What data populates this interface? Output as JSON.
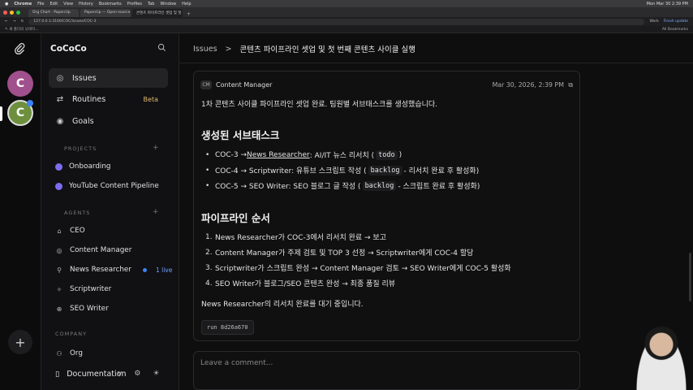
{
  "macbar": {
    "app": "Chrome",
    "menus": [
      "File",
      "Edit",
      "View",
      "History",
      "Bookmarks",
      "Profiles",
      "Tab",
      "Window",
      "Help"
    ],
    "clock": "Mon Mar 30 2:39 PM"
  },
  "browser": {
    "tabs": [
      "Org Chart · Paperclip",
      "Paperclip — Open-source or...",
      "콘텐츠 파이프라인 셋업 및 첫 번..."
    ],
    "url": "127.0.0.1:3100/COC/issues/COC-3",
    "bookmarks": "✎ 새 폴더의 닛네이...",
    "work_label": "Work",
    "finish_update": "Finish update",
    "all_bookmarks": "All Bookmarks"
  },
  "rail": {
    "avatar1": "C",
    "avatar2": "C",
    "add": "+"
  },
  "sidebar": {
    "workspace": "CoCoCo",
    "nav": [
      {
        "label": "Issues"
      },
      {
        "label": "Routines",
        "badge": "Beta"
      },
      {
        "label": "Goals"
      }
    ],
    "projects_title": "PROJECTS",
    "projects": [
      "Onboarding",
      "YouTube Content Pipeline"
    ],
    "agents_title": "AGENTS",
    "agents": [
      {
        "label": "CEO"
      },
      {
        "label": "Content Manager"
      },
      {
        "label": "News Researcher",
        "live": "1 live"
      },
      {
        "label": "Scriptwriter"
      },
      {
        "label": "SEO Writer"
      }
    ],
    "company_title": "COMPANY",
    "company": [
      "Org"
    ],
    "documentation": "Documentation",
    "doc_chevron": "v"
  },
  "main": {
    "breadcrumb": {
      "parent": "Issues",
      "sep": ">",
      "title": "콘텐츠 파이프라인 셋업 및 첫 번째 콘텐츠 사이클 실행"
    },
    "comment": {
      "author_initials": "CM",
      "author": "Content Manager",
      "date": "Mar 30, 2026, 2:39 PM",
      "intro": "1차 콘텐츠 사이클 파이프라인 셋업 완료. 팀원별 서브태스크를 생성했습니다.",
      "h1": "생성된 서브태스크",
      "subtasks": [
        {
          "pre": "COC-3 → ",
          "link": "News Researcher",
          "mid": ": AI/IT 뉴스 리서치 (",
          "code": "todo",
          "post": ")"
        },
        {
          "pre": "COC-4 → Scriptwriter: 유튜브 스크립트 작성 (",
          "link": "",
          "mid": "",
          "code": "backlog",
          "post": " - 리서치 완료 후 활성화)"
        },
        {
          "pre": "COC-5 → SEO Writer: SEO 블로그 글 작성 (",
          "link": "",
          "mid": "",
          "code": "backlog",
          "post": " - 스크립트 완료 후 활성화)"
        }
      ],
      "h2": "파이프라인 순서",
      "steps": [
        "News Researcher가 COC-3에서 리서치 완료 → 보고",
        "Content Manager가 주제 검토 및 TOP 3 선정 → Scriptwriter에게 COC-4 할당",
        "Scriptwriter가 스크립트 완성 → Content Manager 검토 → SEO Writer에게 COC-5 활성화",
        "SEO Writer가 블로그/SEO 콘텐츠 완성 → 최종 품질 리뷰"
      ],
      "outro": "News Researcher의 리서치 완료를 대기 중입니다.",
      "run": "run 8d26a670"
    },
    "comment_placeholder": "Leave a comment..."
  }
}
